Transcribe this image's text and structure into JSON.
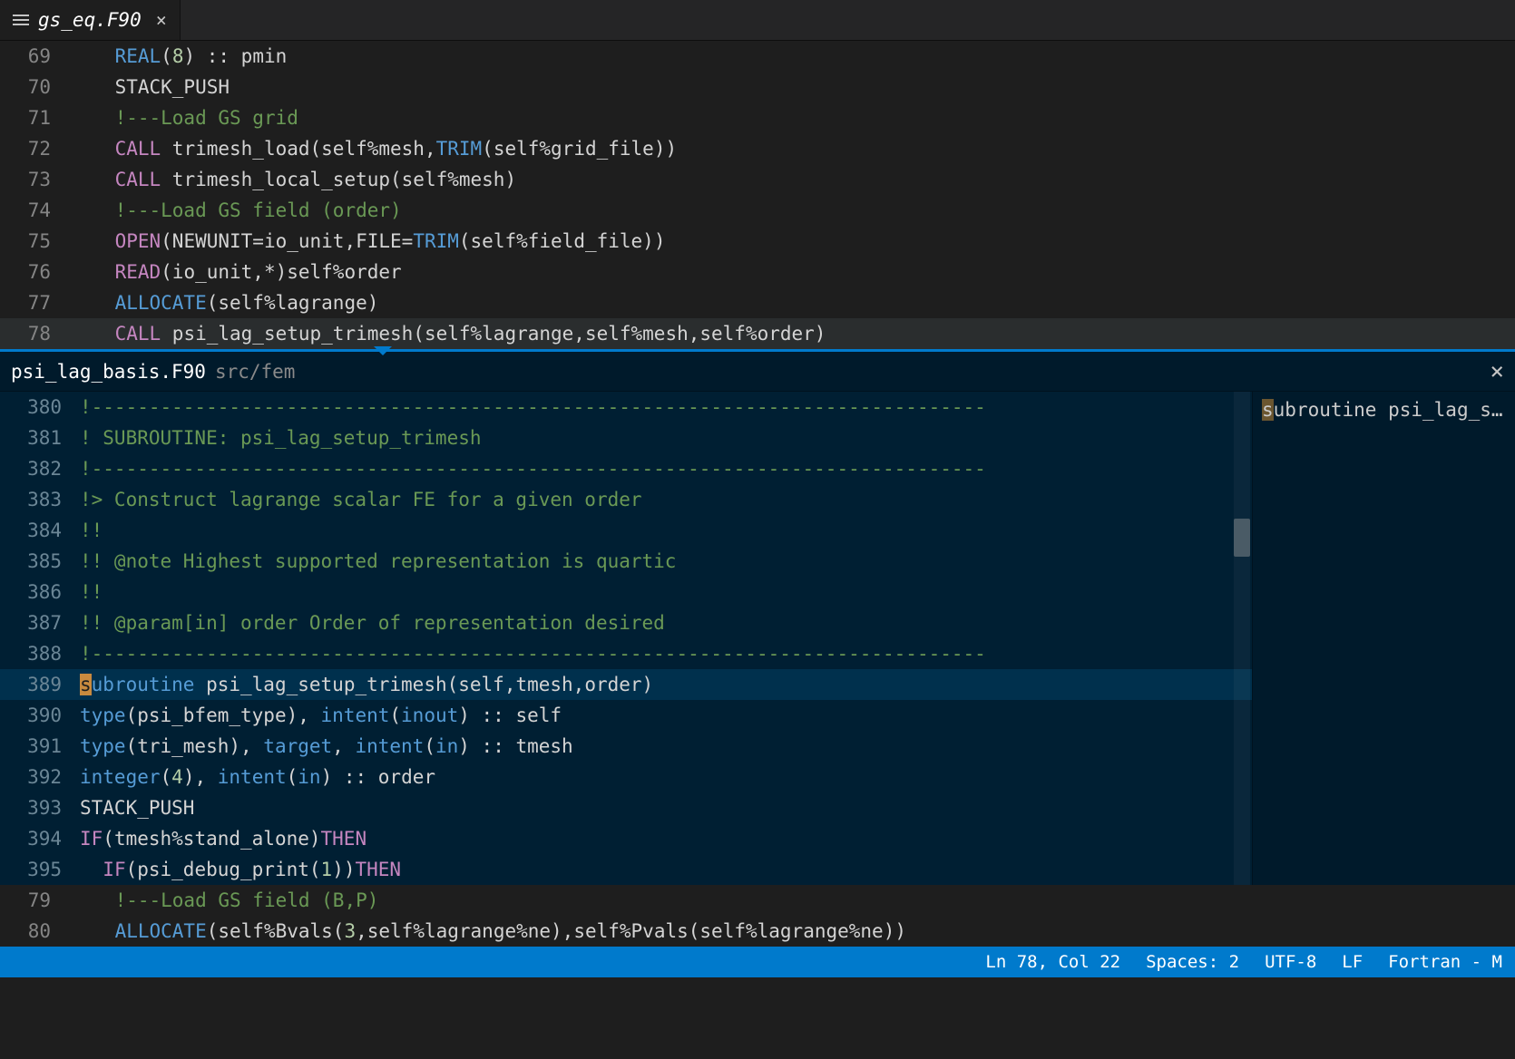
{
  "tab": {
    "name": "gs_eq.F90",
    "close": "×"
  },
  "top": {
    "lines": [
      {
        "n": 69,
        "html": "<span class='c-ty'>REAL</span>(<span class='c-num'>8</span>) :: pmin"
      },
      {
        "n": 70,
        "html": "STACK_PUSH"
      },
      {
        "n": 71,
        "html": "<span class='c-cm'>!---Load GS grid</span>"
      },
      {
        "n": 72,
        "html": "<span class='c-kw'>CALL</span> trimesh_load(self%mesh,<span class='c-ty'>TRIM</span>(self%grid_file))"
      },
      {
        "n": 73,
        "html": "<span class='c-kw'>CALL</span> trimesh_local_setup(self%mesh)"
      },
      {
        "n": 74,
        "html": "<span class='c-cm'>!---Load GS field (order)</span>"
      },
      {
        "n": 75,
        "html": "<span class='c-kw'>OPEN</span>(NEWUNIT=io_unit,FILE=<span class='c-ty'>TRIM</span>(self%field_file))"
      },
      {
        "n": 76,
        "html": "<span class='c-kw'>READ</span>(io_unit,*)self%order"
      },
      {
        "n": 77,
        "html": "<span class='c-ty'>ALLOCATE</span>(self%lagrange)"
      },
      {
        "n": 78,
        "hl": true,
        "html": "<span class='c-kw'>CALL</span> psi_lag_setup_trimesh(self%lagrange,self%mesh,self%order)"
      }
    ]
  },
  "peek": {
    "file": "psi_lag_basis.F90",
    "path": "src/fem",
    "close": "×",
    "ref_html": "<span class='m'>s</span>ubroutine psi_lag_set…",
    "lines": [
      {
        "n": 380,
        "html": "<span class='c-cm'>!------------------------------------------------------------------------------</span>"
      },
      {
        "n": 381,
        "html": "<span class='c-cm'>! SUBROUTINE: psi_lag_setup_trimesh</span>"
      },
      {
        "n": 382,
        "html": "<span class='c-cm'>!------------------------------------------------------------------------------</span>"
      },
      {
        "n": 383,
        "html": "<span class='c-cm'>!&gt; Construct lagrange scalar FE for a given order</span>"
      },
      {
        "n": 384,
        "html": "<span class='c-cm'>!!</span>"
      },
      {
        "n": 385,
        "html": "<span class='c-cm'>!! @note Highest supported representation is quartic</span>"
      },
      {
        "n": 386,
        "html": "<span class='c-cm'>!!</span>"
      },
      {
        "n": 387,
        "html": "<span class='c-cm'>!! @param[in] order Order of representation desired</span>"
      },
      {
        "n": 388,
        "html": "<span class='c-cm'>!------------------------------------------------------------------------------</span>"
      },
      {
        "n": 389,
        "hl": true,
        "html": "<span class='sel'>s</span><span class='c-ty'>ubroutine</span> psi_lag_setup_trimesh(self,tmesh,order)"
      },
      {
        "n": 390,
        "html": "<span class='c-ty'>type</span>(psi_bfem_type), <span class='c-ty'>intent</span>(<span class='c-ty'>inout</span>) :: self"
      },
      {
        "n": 391,
        "html": "<span class='c-ty'>type</span>(tri_mesh), <span class='c-ty'>target</span>, <span class='c-ty'>intent</span>(<span class='c-ty'>in</span>) :: tmesh"
      },
      {
        "n": 392,
        "html": "<span class='c-ty'>integer</span>(<span class='c-num'>4</span>), <span class='c-ty'>intent</span>(<span class='c-ty'>in</span>) :: order"
      },
      {
        "n": 393,
        "html": "STACK_PUSH"
      },
      {
        "n": 394,
        "html": "<span class='c-kw'>IF</span>(tmesh%stand_alone)<span class='c-kw'>THEN</span>"
      },
      {
        "n": 395,
        "html": "  <span class='c-kw'>IF</span>(psi_debug_print(<span class='c-num'>1</span>))<span class='c-kw'>THEN</span>"
      }
    ]
  },
  "bottom": {
    "lines": [
      {
        "n": 79,
        "html": "<span class='c-cm'>!---Load GS field (B,P)</span>"
      },
      {
        "n": 80,
        "html": "<span class='c-ty'>ALLOCATE</span>(self%Bvals(<span class='c-num'>3</span>,self%lagrange%ne),self%Pvals(self%lagrange%ne))"
      }
    ]
  },
  "status": {
    "lncol": "Ln 78, Col 22",
    "spaces": "Spaces: 2",
    "encoding": "UTF-8",
    "eol": "LF",
    "lang": "Fortran - M"
  }
}
